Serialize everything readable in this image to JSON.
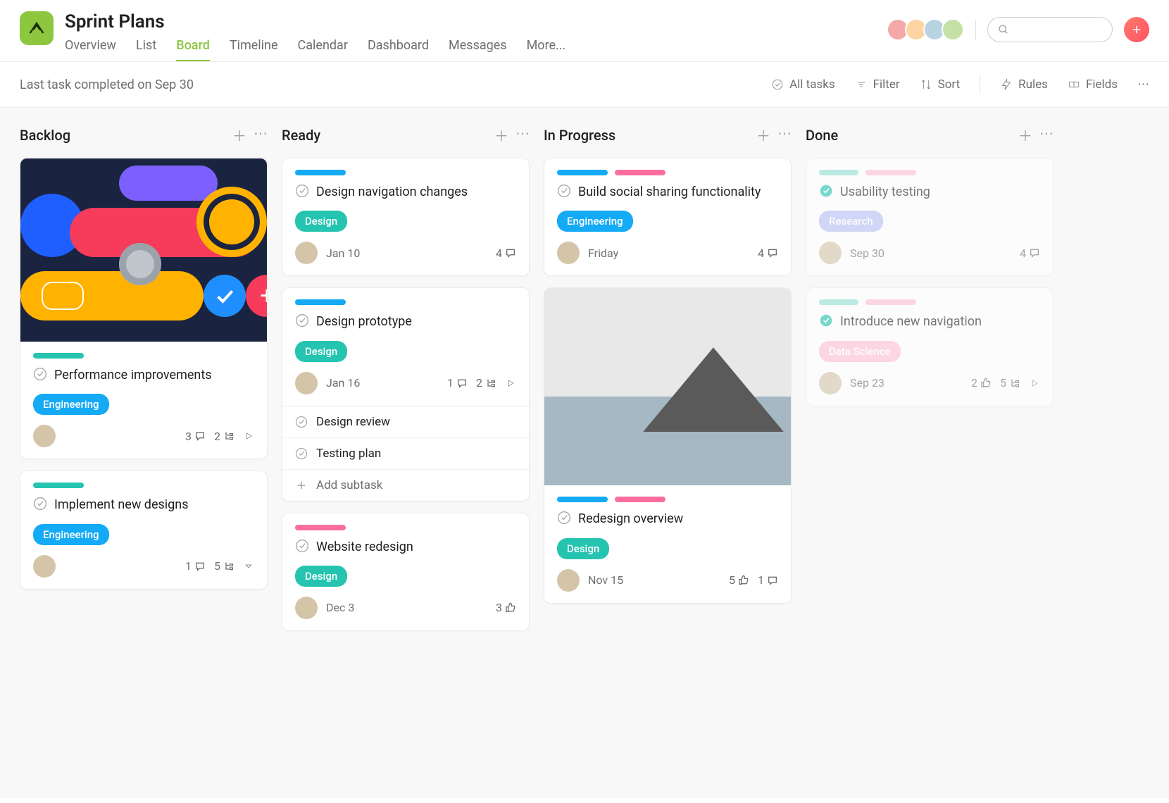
{
  "header": {
    "title": "Sprint Plans",
    "tabs": [
      "Overview",
      "List",
      "Board",
      "Timeline",
      "Calendar",
      "Dashboard",
      "Messages",
      "More..."
    ],
    "active_tab": "Board"
  },
  "subhead": {
    "status": "Last task completed on Sep 30",
    "tools": {
      "all_tasks": "All tasks",
      "filter": "Filter",
      "sort": "Sort",
      "rules": "Rules",
      "fields": "Fields"
    }
  },
  "columns": [
    {
      "title": "Backlog",
      "cards": [
        {
          "has_image": true,
          "image_kind": "shapes",
          "pills": [
            {
              "c": "teal",
              "w": "w50"
            }
          ],
          "title": "Performance improvements",
          "check": "open",
          "tags": [
            {
              "label": "Engineering",
              "cls": "engineering"
            }
          ],
          "assignee": "a",
          "date": "",
          "stats": [
            {
              "v": "3",
              "i": "comment"
            },
            {
              "v": "2",
              "i": "subtask"
            },
            {
              "i": "play"
            }
          ]
        },
        {
          "pills": [
            {
              "c": "teal",
              "w": "w50"
            }
          ],
          "title": "Implement new designs",
          "check": "open",
          "tags": [
            {
              "label": "Engineering",
              "cls": "engineering"
            }
          ],
          "assignee": "b",
          "date": "",
          "stats": [
            {
              "v": "1",
              "i": "comment"
            },
            {
              "v": "5",
              "i": "subtask"
            },
            {
              "i": "caret"
            }
          ]
        }
      ]
    },
    {
      "title": "Ready",
      "cards": [
        {
          "pills": [
            {
              "c": "blue",
              "w": "w50"
            }
          ],
          "title": "Design navigation changes",
          "check": "open",
          "tags": [
            {
              "label": "Design",
              "cls": "design"
            }
          ],
          "assignee": "c",
          "date": "Jan 10",
          "stats": [
            {
              "v": "4",
              "i": "comment"
            }
          ]
        },
        {
          "pills": [
            {
              "c": "blue",
              "w": "w50"
            }
          ],
          "title": "Design prototype",
          "check": "open",
          "tags": [
            {
              "label": "Design",
              "cls": "design"
            }
          ],
          "assignee": "d",
          "date": "Jan 16",
          "stats": [
            {
              "v": "1",
              "i": "comment"
            },
            {
              "v": "2",
              "i": "subtask"
            },
            {
              "i": "play"
            }
          ],
          "subtasks": [
            "Design review",
            "Testing plan"
          ],
          "add_subtask": "Add subtask"
        },
        {
          "pills": [
            {
              "c": "pink",
              "w": "w50"
            }
          ],
          "title": "Website redesign",
          "check": "open",
          "tags": [
            {
              "label": "Design",
              "cls": "design"
            }
          ],
          "assignee": "b",
          "date": "Dec 3",
          "stats": [
            {
              "v": "3",
              "i": "like"
            }
          ]
        }
      ]
    },
    {
      "title": "In Progress",
      "cards": [
        {
          "pills": [
            {
              "c": "blue",
              "w": "w50"
            },
            {
              "c": "pink",
              "w": "w50"
            }
          ],
          "title": "Build social sharing functionality",
          "check": "open",
          "tags": [
            {
              "label": "Engineering",
              "cls": "engineering"
            }
          ],
          "assignee": "e",
          "date": "Friday",
          "stats": [
            {
              "v": "4",
              "i": "comment"
            }
          ]
        },
        {
          "has_image": true,
          "image_kind": "mountain",
          "pills": [
            {
              "c": "blue",
              "w": "w50"
            },
            {
              "c": "pink",
              "w": "w50"
            }
          ],
          "title": "Redesign overview",
          "check": "open",
          "tags": [
            {
              "label": "Design",
              "cls": "design"
            }
          ],
          "assignee": "e",
          "date": "Nov 15",
          "stats": [
            {
              "v": "5",
              "i": "like"
            },
            {
              "v": "1",
              "i": "comment"
            }
          ]
        }
      ]
    },
    {
      "title": "Done",
      "cards": [
        {
          "faded": true,
          "pills": [
            {
              "c": "teal light",
              "w": "w40"
            },
            {
              "c": "pink light",
              "w": "w50"
            }
          ],
          "title": "Usability testing",
          "check": "done",
          "tags": [
            {
              "label": "Research",
              "cls": "research light"
            }
          ],
          "assignee": "f",
          "date": "Sep 30",
          "stats": [
            {
              "v": "4",
              "i": "comment"
            }
          ]
        },
        {
          "faded": true,
          "pills": [
            {
              "c": "teal light",
              "w": "w40"
            },
            {
              "c": "pink light",
              "w": "w50"
            }
          ],
          "title": "Introduce new navigation",
          "check": "done",
          "tags": [
            {
              "label": "Data Science",
              "cls": "datascience"
            }
          ],
          "assignee": "f",
          "date": "Sep 23",
          "stats": [
            {
              "v": "2",
              "i": "like"
            },
            {
              "v": "5",
              "i": "subtask"
            },
            {
              "i": "play"
            }
          ]
        }
      ]
    }
  ]
}
